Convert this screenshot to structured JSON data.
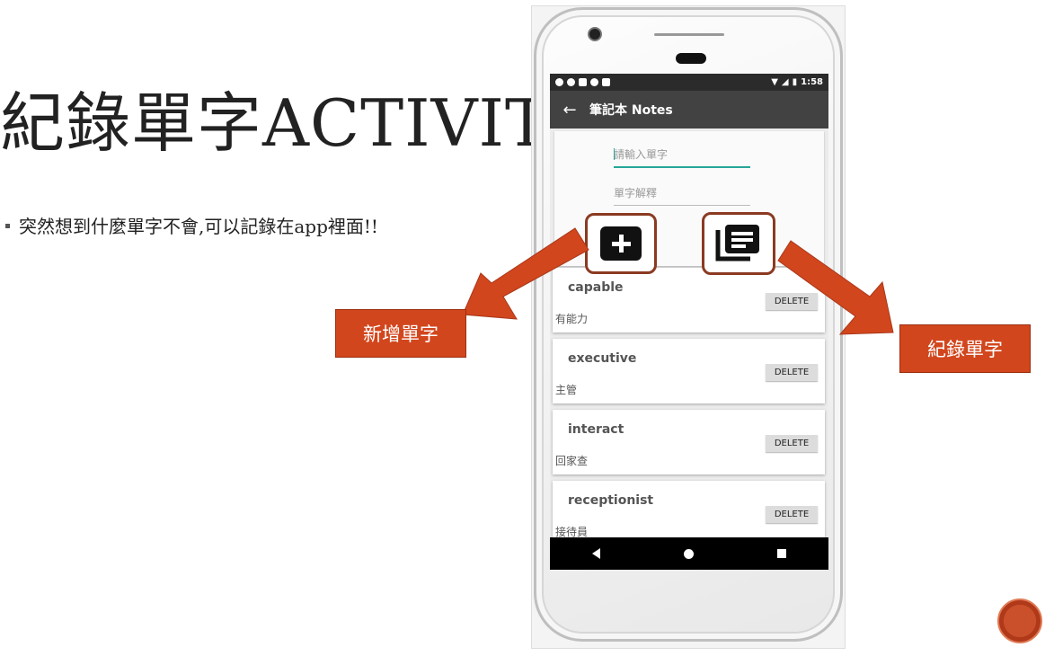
{
  "slide": {
    "title": "紀錄單字ACTIVIT",
    "bullet": "突然想到什麼單字不會,可以記錄在app裡面!!",
    "callout_add": "新增單字",
    "callout_list": "紀錄單字"
  },
  "phone": {
    "status_time": "1:58",
    "appbar_title": "筆記本 Notes",
    "back_icon": "←",
    "form": {
      "word_placeholder": "請輸入單字",
      "definition_placeholder": "單字解釋"
    },
    "notes": [
      {
        "word": "capable",
        "definition": "有能力",
        "delete_label": "DELETE"
      },
      {
        "word": "executive",
        "definition": "主管",
        "delete_label": "DELETE"
      },
      {
        "word": "interact",
        "definition": "回家查",
        "delete_label": "DELETE"
      },
      {
        "word": "receptionist",
        "definition": "接待員",
        "delete_label": "DELETE"
      }
    ]
  },
  "icons": {
    "add": "add-box-icon",
    "list": "notes-list-icon",
    "back": "arrow-back-icon"
  },
  "colors": {
    "accent": "#d2461d",
    "highlight_border": "#8b3a22",
    "input_focus": "#26a69a",
    "appbar": "#424242"
  }
}
